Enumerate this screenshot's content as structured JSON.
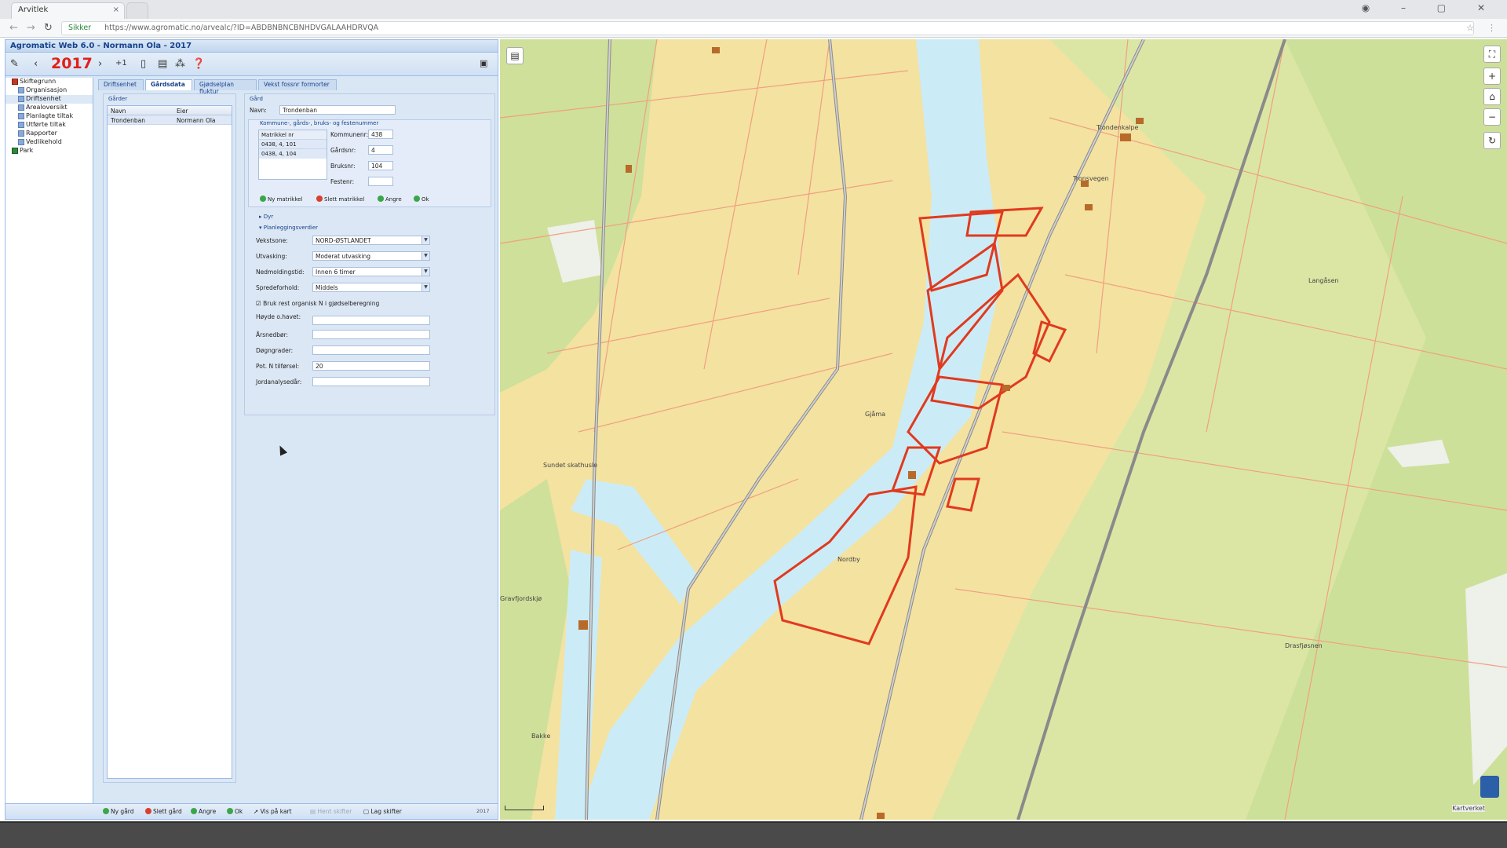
{
  "browser": {
    "tab_title": "Arvitlek",
    "url": "https://www.agromatic.no/arvealc/?ID=ABDBNBNCBNHDVGALAAHDRVQA",
    "secure_label": "Sikker"
  },
  "app": {
    "title": "Agromatic Web 6.0 - Normann Ola - 2017",
    "year": "2017",
    "version": "2017"
  },
  "toolbar": {
    "icons": [
      "pencil-icon",
      "back-icon",
      "forward-icon",
      "plus-one-icon",
      "mobile-icon",
      "message-icon",
      "chart-icon",
      "help-icon"
    ]
  },
  "tree": {
    "items": [
      {
        "label": "Skiftegrunn",
        "level": "root"
      },
      {
        "label": "Organisasjon"
      },
      {
        "label": "Driftsenhet",
        "selected": true
      },
      {
        "label": "Arealoversikt"
      },
      {
        "label": "Planlagte tiltak"
      },
      {
        "label": "Utførte tiltak"
      },
      {
        "label": "Rapporter"
      },
      {
        "label": "Vedlikehold"
      },
      {
        "label": "Park",
        "level": "park"
      }
    ]
  },
  "tabs": [
    "Driftsenhet",
    "Gårdsdata",
    "Gjødselplan fluktur",
    "Vekst fossnr formorter"
  ],
  "list": {
    "legend": "Gårder",
    "columns": [
      "Navn",
      "Eier"
    ],
    "rows": [
      {
        "name": "Trondenban",
        "owner": "Normann Ola"
      }
    ]
  },
  "details": {
    "legend": "Gård",
    "name_label": "Navn:",
    "name_value": "Trondenban",
    "matrikkel_legend": "Kommune-, gårds-, bruks- og festenummer",
    "matrikkel_header": "Matrikkel nr",
    "matrikkel_rows": [
      "0438, 4, 101",
      "0438, 4, 104"
    ],
    "kommune_label": "Kommunenr:",
    "kommune_value": "438",
    "gard_label": "Gårdsnr:",
    "gard_value": "4",
    "bruk_label": "Bruksnr:",
    "bruk_value": "104",
    "feste_label": "Festenr:",
    "feste_value": "",
    "btn_new": "Ny matrikkel",
    "btn_delete": "Slett matrikkel",
    "btn_copy": "Angre",
    "btn_ok": "Ok",
    "section_dyr": "Dyr",
    "section_plan": "Planleggingsverdier",
    "vekstsone_label": "Vekstsone:",
    "vekstsone_value": "NORD-ØSTLANDET",
    "utvasking_label": "Utvasking:",
    "utvasking_value": "Moderat utvasking",
    "nedbor_label": "Nedmoldingstid:",
    "nedbor_value": "Innen 6 timer",
    "spredeforhold_label": "Spredeforhold:",
    "spredeforhold_value": "Middels",
    "checkbox_label": "Bruk rest organisk N i gjødselberegning",
    "hoyde_label": "Høyde o.havet:",
    "arsnedbor_label": "Årsnedbør:",
    "dognrader_label": "Døgngrader:",
    "pot_label": "Pot. N tilførsel:",
    "pot_value": "20",
    "jord_label": "Jordanalysedår:"
  },
  "bottom_bar": {
    "new": "Ny gård",
    "delete": "Slett gård",
    "undo": "Angre",
    "ok": "Ok",
    "map": "Vis på kart",
    "import": "Hent skifter",
    "save": "Lag skifter"
  },
  "map": {
    "labels": [
      "Trondenkalpe",
      "Tronsvegen",
      "Langåsen",
      "Gjåma",
      "Sundet skathusle",
      "Nordby",
      "Gravfjordskjø",
      "Drasfjøsnen",
      "Bakke"
    ],
    "attribution": "Kartverket",
    "colors": {
      "field": "#f4e2a0",
      "forest": "#dde7a6",
      "water": "#cbecf7",
      "boundary": "#e03a1f"
    }
  }
}
